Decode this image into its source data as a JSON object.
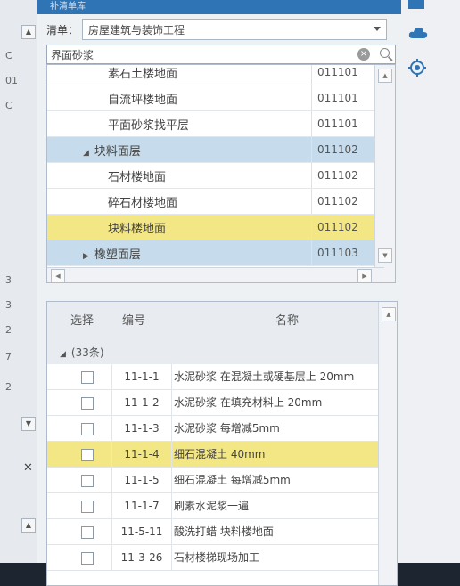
{
  "panel": {
    "title": "补清单库"
  },
  "toolbar": {
    "list_label": "清单：",
    "list_value": "房屋建筑与装饰工程"
  },
  "search": {
    "value": "界面砂浆"
  },
  "left": {
    "rows": [
      "C",
      "01",
      "C",
      "3",
      "3",
      "2",
      "7",
      "2"
    ]
  },
  "tree": [
    {
      "name": "素石土楼地面",
      "code": "011101",
      "type": "leaf",
      "style": ""
    },
    {
      "name": "自流坪楼地面",
      "code": "011101",
      "type": "leaf",
      "style": ""
    },
    {
      "name": "平面砂浆找平层",
      "code": "011101",
      "type": "leaf",
      "style": ""
    },
    {
      "name": "块料面层",
      "code": "011102",
      "type": "group-open",
      "style": "blue"
    },
    {
      "name": "石材楼地面",
      "code": "011102",
      "type": "leaf",
      "style": ""
    },
    {
      "name": "碎石材楼地面",
      "code": "011102",
      "type": "leaf",
      "style": ""
    },
    {
      "name": "块料楼地面",
      "code": "011102",
      "type": "leaf",
      "style": "yellow"
    },
    {
      "name": "橡塑面层",
      "code": "011103",
      "type": "group-closed",
      "style": "blue"
    }
  ],
  "grid": {
    "headers": {
      "select": "选择",
      "code": "编号",
      "name": "名称"
    },
    "group_label": "(33条)",
    "rows": [
      {
        "code": "11-1-1",
        "name": "水泥砂浆 在混凝土或硬基层上 20mm",
        "style": ""
      },
      {
        "code": "11-1-2",
        "name": "水泥砂浆 在填充材料上 20mm",
        "style": ""
      },
      {
        "code": "11-1-3",
        "name": "水泥砂浆 每增减5mm",
        "style": ""
      },
      {
        "code": "11-1-4",
        "name": "细石混凝土 40mm",
        "style": "yellow"
      },
      {
        "code": "11-1-5",
        "name": "细石混凝土 每增减5mm",
        "style": ""
      },
      {
        "code": "11-1-7",
        "name": "刷素水泥浆一遍",
        "style": ""
      },
      {
        "code": "11-5-11",
        "name": "酸洗打蜡 块料楼地面",
        "style": ""
      },
      {
        "code": "11-3-26",
        "name": "石材楼梯现场加工",
        "style": ""
      }
    ]
  },
  "colors": {
    "accent": "#2f74b5",
    "group_row": "#c6dcec",
    "highlight_row": "#f3e785"
  },
  "icons": [
    "cloud-icon",
    "target-icon",
    "close-icon",
    "clear-search-icon",
    "magnifier-icon"
  ]
}
